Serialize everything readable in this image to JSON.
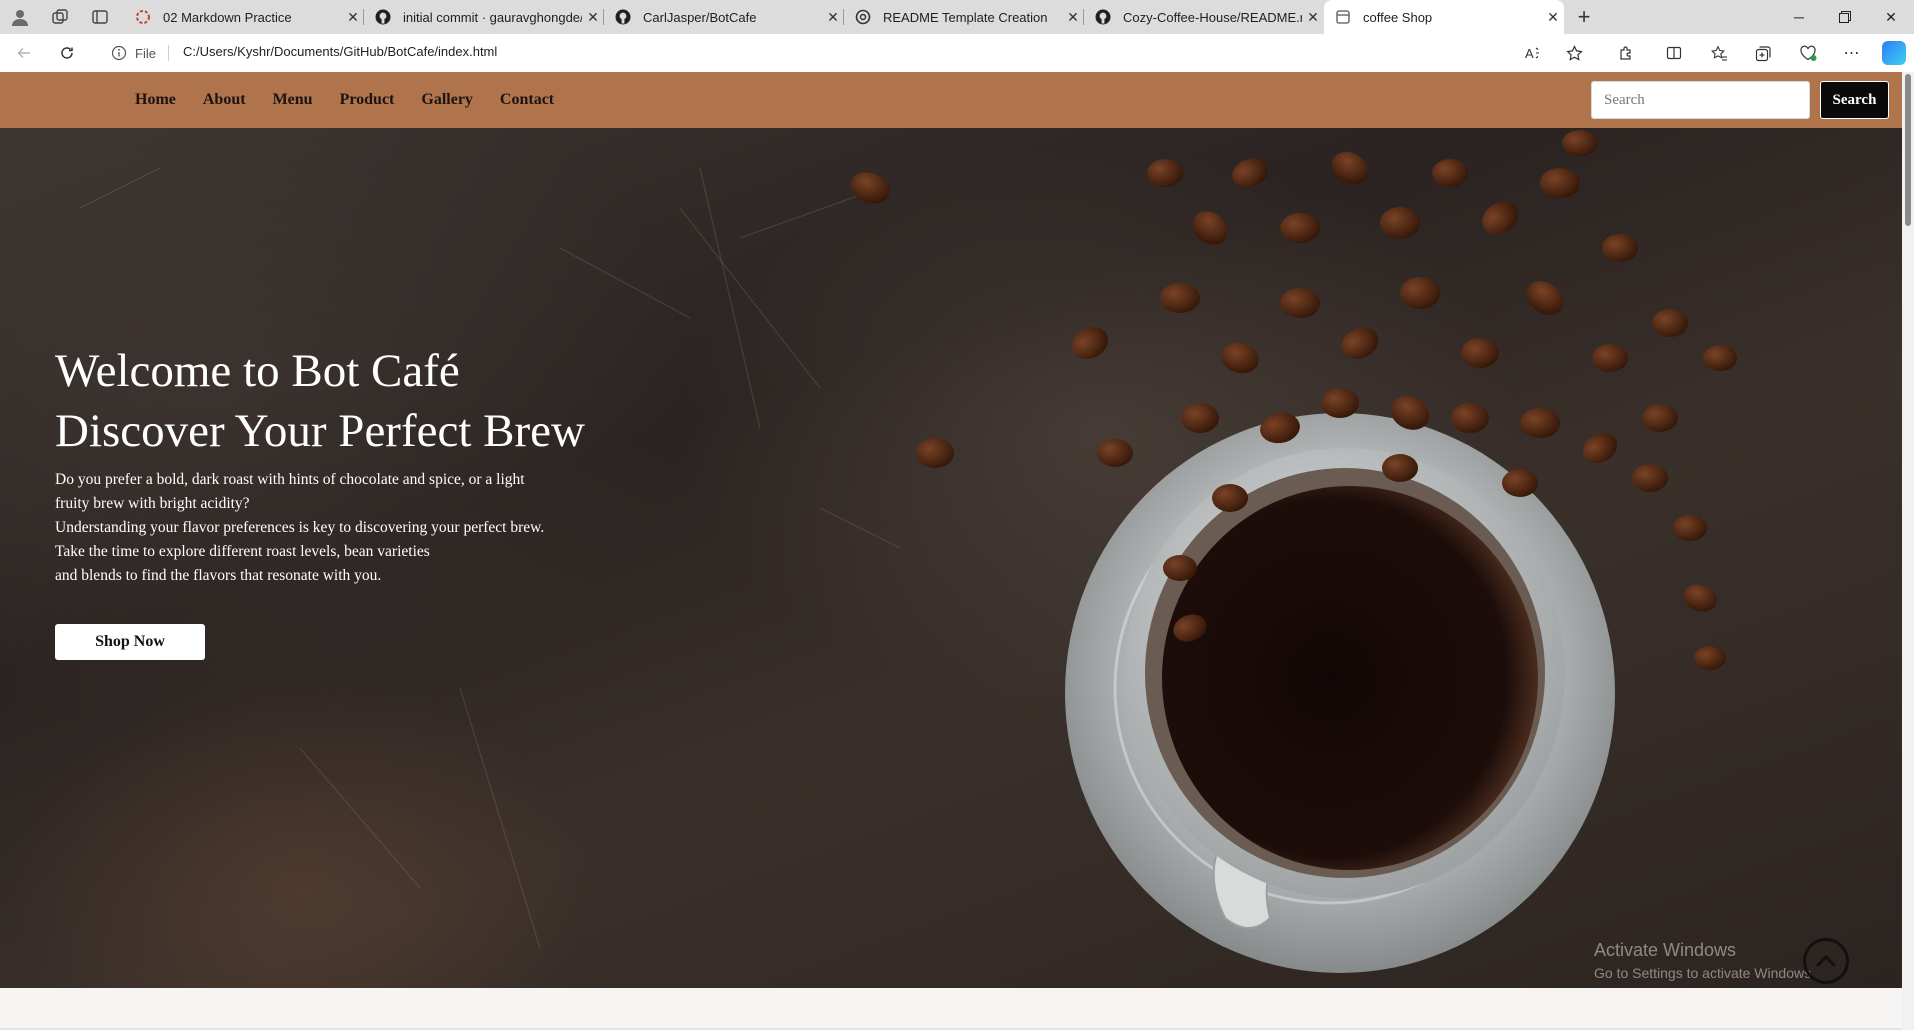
{
  "browser": {
    "tabs": [
      {
        "title": "02 Markdown Practice",
        "favicon": "loading-spinner-icon"
      },
      {
        "title": "initial commit · gauravghongde/s",
        "favicon": "github-icon"
      },
      {
        "title": "CarlJasper/BotCafe",
        "favicon": "github-icon"
      },
      {
        "title": "README Template Creation",
        "favicon": "openai-icon"
      },
      {
        "title": "Cozy-Coffee-House/README.md",
        "favicon": "github-icon"
      },
      {
        "title": "coffee Shop",
        "favicon": "page-icon",
        "active": true
      }
    ],
    "address": {
      "scheme_label": "File",
      "url": "C:/Users/Kyshr/Documents/GitHub/BotCafe/index.html"
    }
  },
  "site": {
    "nav": [
      "Home",
      "About",
      "Menu",
      "Product",
      "Gallery",
      "Contact"
    ],
    "search": {
      "placeholder": "Search",
      "button_label": "Search"
    },
    "hero": {
      "title_line1": "Welcome to Bot Café",
      "title_line2": "Discover Your Perfect Brew",
      "description": [
        "Do you prefer a bold, dark roast with hints of chocolate and spice, or a light",
        "fruity brew with bright acidity?",
        "Understanding your flavor preferences is key to discovering your perfect brew.",
        "Take the time to explore different roast levels, bean varieties",
        "and blends to find the flavors that resonate with you."
      ],
      "cta_label": "Shop Now"
    }
  },
  "os": {
    "watermark_title": "Activate Windows",
    "watermark_subtitle": "Go to Settings to activate Windows."
  },
  "colors": {
    "navbar": "#b0744d",
    "hero_bg": "#2e2724",
    "search_button": "#0a0a0a"
  }
}
